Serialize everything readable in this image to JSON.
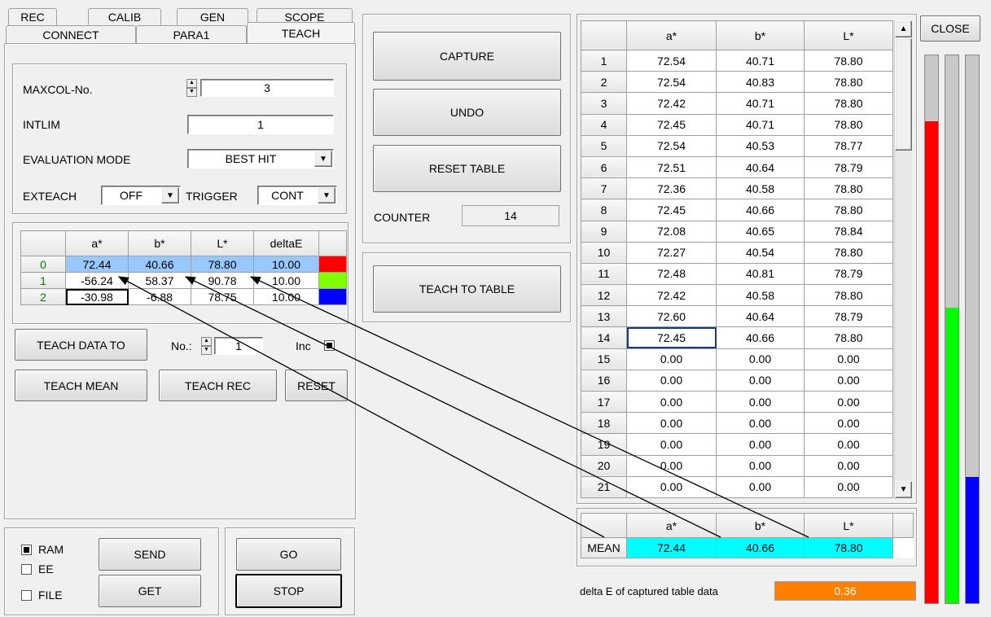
{
  "tabs_row1": [
    "REC",
    "CALIB",
    "GEN",
    "SCOPE"
  ],
  "tabs_row2": [
    "CONNECT",
    "PARA1",
    "TEACH"
  ],
  "params": {
    "maxcol_label": "MAXCOL-No.",
    "maxcol_value": "3",
    "intlim_label": "INTLIM",
    "intlim_value": "1",
    "evalmode_label": "EVALUATION MODE",
    "evalmode_value": "BEST HIT",
    "exteach_label": "EXTEACH",
    "exteach_value": "OFF",
    "trigger_label": "TRIGGER",
    "trigger_value": "CONT"
  },
  "teach_table": {
    "headers": [
      "a*",
      "b*",
      "L*",
      "deltaE"
    ],
    "rows": [
      {
        "index": "0",
        "a": "72.44",
        "b": "40.66",
        "L": "78.80",
        "dE": "10.00",
        "color": "#ff0000"
      },
      {
        "index": "1",
        "a": "-56.24",
        "b": "58.37",
        "L": "90.78",
        "dE": "10.00",
        "color": "#80ff00"
      },
      {
        "index": "2",
        "a": "-30.98",
        "b": "-6.88",
        "L": "78.75",
        "dE": "10.00",
        "color": "#0000ff"
      }
    ]
  },
  "teach_controls": {
    "teach_data_to": "TEACH DATA TO",
    "no_label": "No.:",
    "no_value": "1",
    "inc_label": "Inc",
    "teach_mean": "TEACH MEAN",
    "teach_rec": "TEACH REC",
    "reset": "RESET"
  },
  "storage": {
    "ram": "RAM",
    "ee": "EE",
    "file": "FILE",
    "send": "SEND",
    "get": "GET",
    "go": "GO",
    "stop": "STOP"
  },
  "capture_panel": {
    "capture": "CAPTURE",
    "undo": "UNDO",
    "reset_table": "RESET TABLE",
    "counter_label": "COUNTER",
    "counter_value": "14",
    "teach_to_table": "TEACH TO TABLE"
  },
  "capture_table": {
    "headers": [
      "a*",
      "b*",
      "L*"
    ],
    "rows": [
      [
        "1",
        "72.54",
        "40.71",
        "78.80"
      ],
      [
        "2",
        "72.54",
        "40.83",
        "78.80"
      ],
      [
        "3",
        "72.42",
        "40.71",
        "78.80"
      ],
      [
        "4",
        "72.45",
        "40.71",
        "78.80"
      ],
      [
        "5",
        "72.54",
        "40.53",
        "78.77"
      ],
      [
        "6",
        "72.51",
        "40.64",
        "78.79"
      ],
      [
        "7",
        "72.36",
        "40.58",
        "78.80"
      ],
      [
        "8",
        "72.45",
        "40.66",
        "78.80"
      ],
      [
        "9",
        "72.08",
        "40.65",
        "78.84"
      ],
      [
        "10",
        "72.27",
        "40.54",
        "78.80"
      ],
      [
        "11",
        "72.48",
        "40.81",
        "78.79"
      ],
      [
        "12",
        "72.42",
        "40.58",
        "78.80"
      ],
      [
        "13",
        "72.60",
        "40.64",
        "78.79"
      ],
      [
        "14",
        "72.45",
        "40.66",
        "78.80"
      ],
      [
        "15",
        "0.00",
        "0.00",
        "0.00"
      ],
      [
        "16",
        "0.00",
        "0.00",
        "0.00"
      ],
      [
        "17",
        "0.00",
        "0.00",
        "0.00"
      ],
      [
        "18",
        "0.00",
        "0.00",
        "0.00"
      ],
      [
        "19",
        "0.00",
        "0.00",
        "0.00"
      ],
      [
        "20",
        "0.00",
        "0.00",
        "0.00"
      ],
      [
        "21",
        "0.00",
        "0.00",
        "0.00"
      ]
    ]
  },
  "mean_table": {
    "headers": [
      "a*",
      "b*",
      "L*"
    ],
    "label": "MEAN",
    "a": "72.44",
    "b": "40.66",
    "L": "78.80"
  },
  "delta_e": {
    "label": "delta E of captured table data",
    "value": "0.36"
  },
  "close": "CLOSE",
  "signal_bars": [
    {
      "color": "#ff0000",
      "level": 0.88
    },
    {
      "color": "#00ff00",
      "level": 0.54
    },
    {
      "color": "#0000ff",
      "level": 0.23
    }
  ]
}
